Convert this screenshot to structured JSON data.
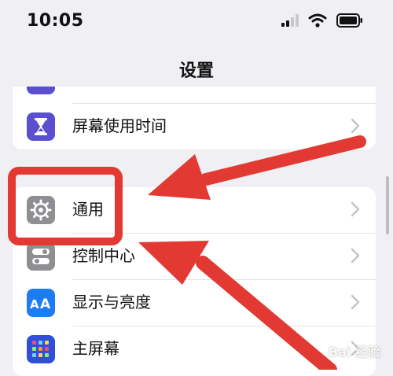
{
  "status_bar": {
    "time": "10:05",
    "icons": [
      "cellular-signal-icon",
      "wifi-icon",
      "battery-icon"
    ]
  },
  "nav": {
    "title": "设置"
  },
  "settings": {
    "top_group": [
      {
        "label": "屏幕使用时间",
        "icon": "hourglass-icon",
        "icon_color": "#5a4fcf"
      }
    ],
    "main_group": [
      {
        "label": "通用",
        "icon": "gear-icon",
        "icon_color": "#8e8e93"
      },
      {
        "label": "控制中心",
        "icon": "toggle-icon",
        "icon_color": "#8e8e93"
      },
      {
        "label": "显示与亮度",
        "icon": "text-size-icon",
        "icon_color": "#1e7cf2"
      },
      {
        "label": "主屏幕",
        "icon": "app-grid-icon",
        "icon_color": "#2f4fd8"
      }
    ]
  },
  "annotation": {
    "highlight_color": "#e23a33"
  },
  "watermark": {
    "text": "Bai 经验"
  }
}
